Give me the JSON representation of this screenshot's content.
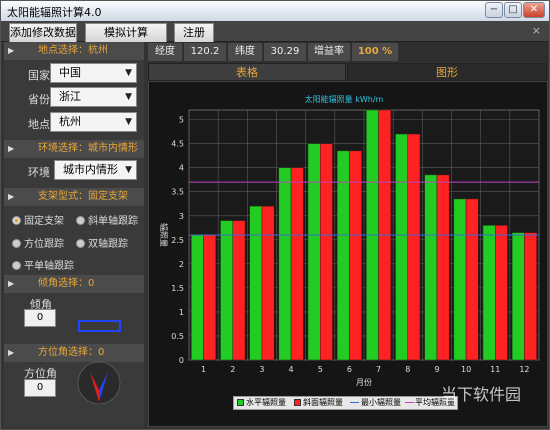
{
  "window": {
    "title": "太阳能辐照计算4.0"
  },
  "menu": {
    "tabs": [
      "添加修改数据",
      "模拟计算",
      "注册"
    ],
    "close_label": "×"
  },
  "location": {
    "header": "地点选择：杭州",
    "country_label": "国家",
    "country": "中国",
    "province_label": "省份",
    "province": "浙江",
    "place_label": "地点",
    "place": "杭州"
  },
  "environment": {
    "header": "环境选择：城市内情形",
    "label": "环境",
    "value": "城市内情形"
  },
  "mount": {
    "header": "支架型式：固定支架",
    "options": [
      "固定支架",
      "斜单轴跟踪",
      "方位跟踪",
      "双轴跟踪",
      "平单轴跟踪"
    ],
    "selected": "固定支架"
  },
  "tilt": {
    "header": "倾角选择：0",
    "label": "倾角",
    "value": "0"
  },
  "azimuth": {
    "header": "方位角选择：0",
    "label": "方位角",
    "value": "0"
  },
  "topbar": {
    "lon_label": "经度",
    "lon": "120.2",
    "lat_label": "纬度",
    "lat": "30.29",
    "gain_label": "增益率",
    "gain": "100 %"
  },
  "view_tabs": [
    "表格",
    "图形"
  ],
  "colors": {
    "horizontal": "#22cc22",
    "tilted": "#ff2222",
    "min_line": "#3b6bd6",
    "avg_line": "#c040c0",
    "title": "#33c3e0",
    "accent": "#e8a73a"
  },
  "chart_data": {
    "type": "bar",
    "title": "太阳能辐照量 kWh/m",
    "xlabel": "月份",
    "ylabel": "辐照量",
    "ylim": [
      0,
      5.2
    ],
    "yticks": [
      0,
      0.5,
      1,
      1.5,
      2,
      2.5,
      3,
      3.5,
      4,
      4.5,
      5
    ],
    "categories": [
      "1",
      "2",
      "3",
      "4",
      "5",
      "6",
      "7",
      "8",
      "9",
      "10",
      "11",
      "12"
    ],
    "series": [
      {
        "name": "水平辐照量",
        "values": [
          2.6,
          2.9,
          3.2,
          4.0,
          4.5,
          4.35,
          5.2,
          4.7,
          3.85,
          3.35,
          2.8,
          2.65
        ]
      },
      {
        "name": "斜面辐照量",
        "values": [
          2.6,
          2.9,
          3.2,
          4.0,
          4.5,
          4.35,
          5.2,
          4.7,
          3.85,
          3.35,
          2.8,
          2.65
        ]
      }
    ],
    "lines": [
      {
        "name": "最小辐照量",
        "value": 2.6
      },
      {
        "name": "平均辐照量",
        "value": 3.7
      }
    ],
    "legend_position": "bottom-right"
  },
  "watermark": "当下软件园"
}
